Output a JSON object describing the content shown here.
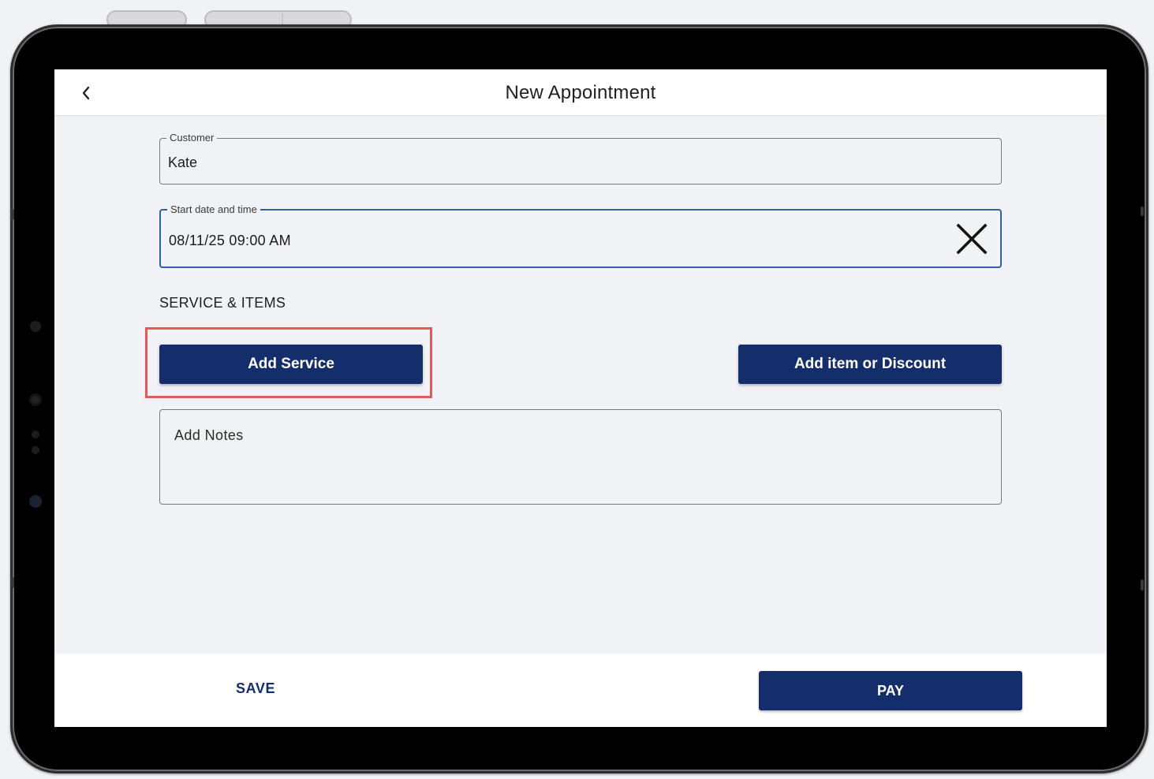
{
  "header": {
    "title": "New Appointment",
    "back_icon": "chevron-left-icon"
  },
  "form": {
    "customer": {
      "label": "Customer",
      "value": "Kate"
    },
    "start": {
      "label": "Start date and time",
      "value": "08/11/25 09:00 AM",
      "clear_icon": "close-icon"
    },
    "section_title": "SERVICE & ITEMS",
    "add_service_label": "Add Service",
    "add_item_label": "Add item or Discount",
    "notes_placeholder": "Add Notes"
  },
  "footer": {
    "save_label": "SAVE",
    "pay_label": "PAY"
  },
  "colors": {
    "primary": "#142d6b",
    "highlight": "#e05a5a",
    "focus_border": "#2f5fa8",
    "background": "#f1f2f6"
  }
}
